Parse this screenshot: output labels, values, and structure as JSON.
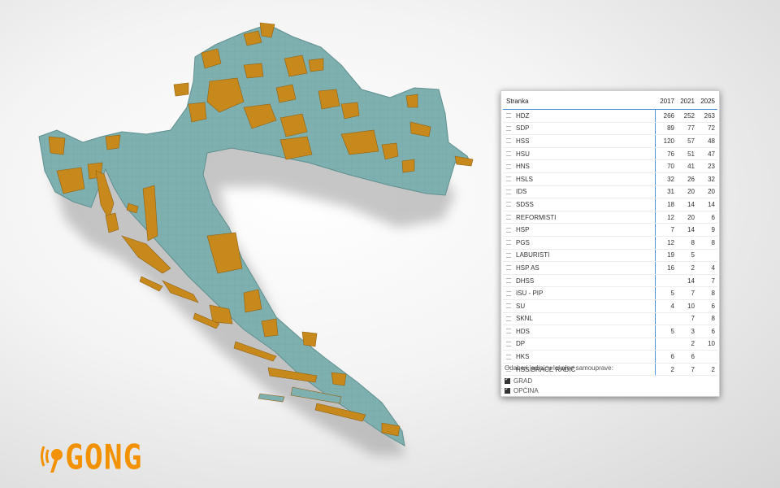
{
  "table": {
    "header": {
      "name": "Stranka",
      "y2017": "2017",
      "y2021": "2021",
      "y2025": "2025"
    },
    "rows": [
      {
        "name": "HDZ",
        "y2017": "266",
        "y2021": "252",
        "y2025": "263"
      },
      {
        "name": "SDP",
        "y2017": "89",
        "y2021": "77",
        "y2025": "72"
      },
      {
        "name": "HSS",
        "y2017": "120",
        "y2021": "57",
        "y2025": "48"
      },
      {
        "name": "HSU",
        "y2017": "76",
        "y2021": "51",
        "y2025": "47"
      },
      {
        "name": "HNS",
        "y2017": "70",
        "y2021": "41",
        "y2025": "23"
      },
      {
        "name": "HSLS",
        "y2017": "32",
        "y2021": "26",
        "y2025": "32"
      },
      {
        "name": "IDS",
        "y2017": "31",
        "y2021": "20",
        "y2025": "20"
      },
      {
        "name": "SDSS",
        "y2017": "18",
        "y2021": "14",
        "y2025": "14"
      },
      {
        "name": "REFORMISTI",
        "y2017": "12",
        "y2021": "20",
        "y2025": "6"
      },
      {
        "name": "HSP",
        "y2017": "7",
        "y2021": "14",
        "y2025": "9"
      },
      {
        "name": "PGS",
        "y2017": "12",
        "y2021": "8",
        "y2025": "8"
      },
      {
        "name": "LABURISTI",
        "y2017": "19",
        "y2021": "5",
        "y2025": ""
      },
      {
        "name": "HSP AS",
        "y2017": "16",
        "y2021": "2",
        "y2025": "4"
      },
      {
        "name": "DHSS",
        "y2017": "",
        "y2021": "14",
        "y2025": "7"
      },
      {
        "name": "ISU - PIP",
        "y2017": "5",
        "y2021": "7",
        "y2025": "8"
      },
      {
        "name": "SU",
        "y2017": "4",
        "y2021": "10",
        "y2025": "6"
      },
      {
        "name": "SKNL",
        "y2017": "",
        "y2021": "7",
        "y2025": "8"
      },
      {
        "name": "HDS",
        "y2017": "5",
        "y2021": "3",
        "y2025": "6"
      },
      {
        "name": "DP",
        "y2017": "",
        "y2021": "2",
        "y2025": "10"
      },
      {
        "name": "HKS",
        "y2017": "6",
        "y2021": "6",
        "y2025": ""
      },
      {
        "name": "HSS BRAĆE RADIĆ",
        "y2017": "2",
        "y2021": "7",
        "y2025": "2"
      }
    ]
  },
  "slicer": {
    "title": "Odaberi jedinicu lokalne samouprave:",
    "options": [
      {
        "label": "GRAD",
        "checked": true
      },
      {
        "label": "OPĆINA",
        "checked": true
      }
    ]
  },
  "logo": {
    "text": "GONG"
  },
  "colors": {
    "map_teal": "#7fb0b0",
    "map_highlight": "#c8891c",
    "logo": "#f39200",
    "accent": "#4a90d9"
  }
}
